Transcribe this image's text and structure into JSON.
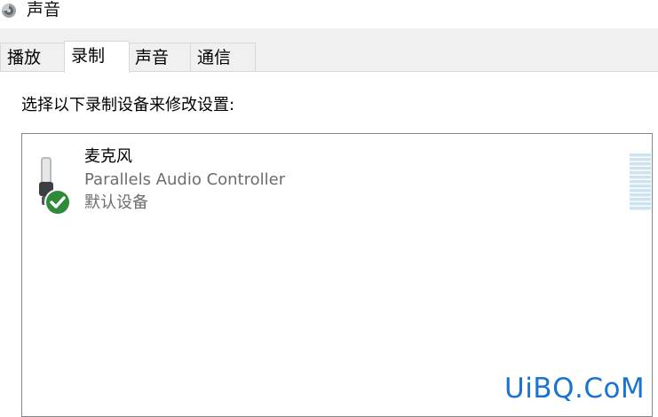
{
  "window": {
    "title": "声音",
    "icon": "speaker-icon"
  },
  "tabs": [
    {
      "label": "播放",
      "active": false
    },
    {
      "label": "录制",
      "active": true
    },
    {
      "label": "声音",
      "active": false
    },
    {
      "label": "通信",
      "active": false
    }
  ],
  "recording": {
    "instruction": "选择以下录制设备来修改设置:",
    "devices": [
      {
        "name": "麦克风",
        "description": "Parallels Audio Controller",
        "status": "默认设备",
        "icon": "microphone-icon",
        "badge": "default-checkmark-icon"
      }
    ]
  },
  "watermark": "UiBQ.CoM",
  "colors": {
    "tab_strip_bg": "#f0f0f0",
    "secondary_text": "#6d6d6d",
    "default_badge": "#2e8b3a",
    "level_meter": "#cce3f0",
    "watermark": "#1a73d4"
  }
}
